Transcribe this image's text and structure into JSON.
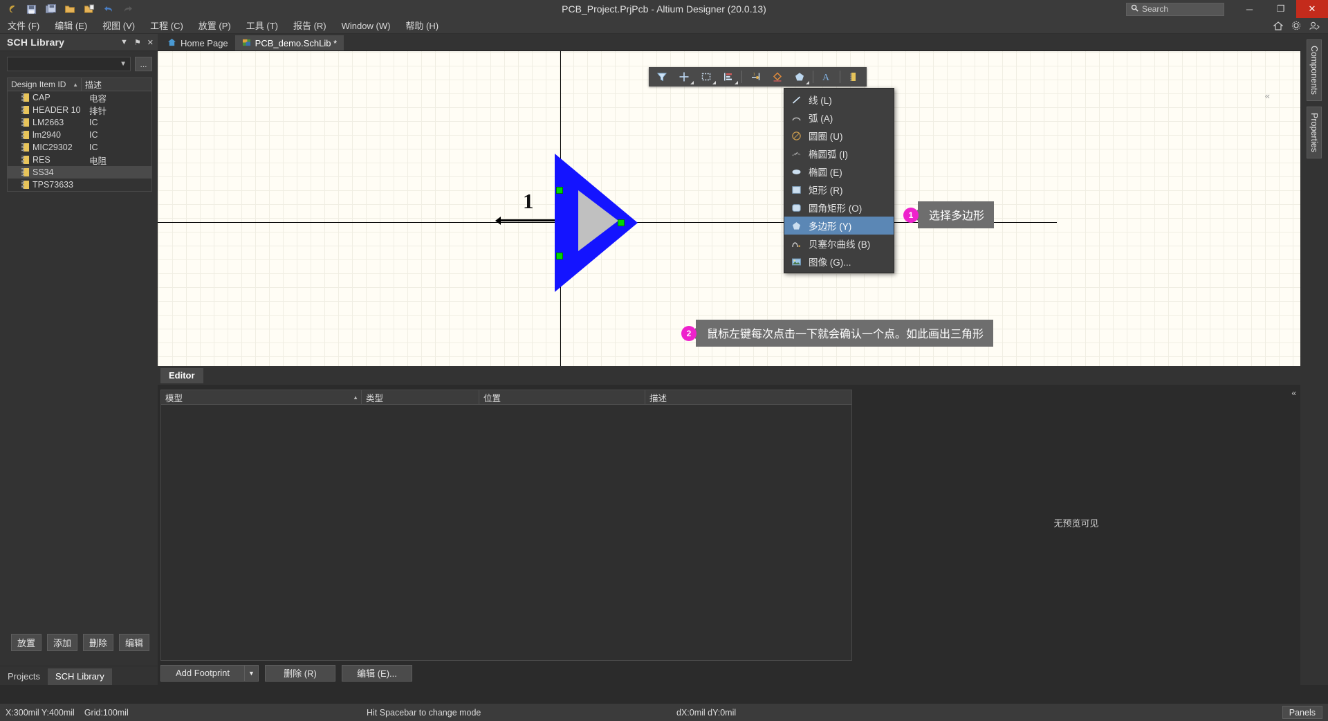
{
  "titlebar": {
    "title": "PCB_Project.PrjPcb - Altium Designer (20.0.13)",
    "search_placeholder": "Search",
    "icons": [
      "altium-logo-icon",
      "save-icon",
      "save-all-icon",
      "open-folder-icon",
      "open-project-icon",
      "undo-icon",
      "redo-icon"
    ],
    "minimize_label": "─",
    "restore_label": "❐",
    "close_label": "✕"
  },
  "menubar": {
    "items": [
      {
        "label": "文件 (F)",
        "key": "F"
      },
      {
        "label": "编辑 (E)",
        "key": "E"
      },
      {
        "label": "视图 (V)",
        "key": "V"
      },
      {
        "label": "工程 (C)",
        "key": "C"
      },
      {
        "label": "放置 (P)",
        "key": "P"
      },
      {
        "label": "工具 (T)",
        "key": "T"
      },
      {
        "label": "报告 (R)",
        "key": "R"
      },
      {
        "label": "Window (W)",
        "key": "W"
      },
      {
        "label": "帮助 (H)",
        "key": "H"
      }
    ],
    "right_icons": [
      "home-icon",
      "gear-icon",
      "user-icon"
    ]
  },
  "sch_library": {
    "title": "SCH Library",
    "collapse_label": "▼",
    "pin_label": "⚑",
    "close_label": "✕",
    "filter_value": "",
    "browse_label": "...",
    "columns": {
      "id": "Design Item ID",
      "desc": "描述"
    },
    "sort_indicator": "▲",
    "items": [
      {
        "name": "CAP",
        "desc": "电容",
        "selected": false
      },
      {
        "name": "HEADER 10",
        "desc": "排针",
        "selected": false
      },
      {
        "name": "LM2663",
        "desc": "IC",
        "selected": false
      },
      {
        "name": "lm2940",
        "desc": "IC",
        "selected": false
      },
      {
        "name": "MIC29302",
        "desc": "IC",
        "selected": false
      },
      {
        "name": "RES",
        "desc": "电阻",
        "selected": false
      },
      {
        "name": "SS34",
        "desc": "",
        "selected": true
      },
      {
        "name": "TPS73633",
        "desc": "",
        "selected": false
      }
    ],
    "buttons": [
      "放置",
      "添加",
      "删除",
      "编辑"
    ],
    "panel_tabs": [
      {
        "label": "Projects",
        "active": false
      },
      {
        "label": "SCH Library",
        "active": true
      }
    ]
  },
  "document_tabs": [
    {
      "label": "Home Page",
      "icon": "home-icon",
      "active": false
    },
    {
      "label": "PCB_demo.SchLib *",
      "icon": "schlib-icon",
      "active": true
    }
  ],
  "canvas": {
    "pin_number": "1",
    "symbol": "triangle-amplifier",
    "vertex_color": "#00d800",
    "body_color": "#1414ff",
    "inner_color": "#c0c0c0",
    "collapse_label": "«"
  },
  "float_toolbar": {
    "buttons": [
      {
        "name": "filter-icon",
        "has_menu": false
      },
      {
        "name": "crosshair-place-icon",
        "has_menu": true
      },
      {
        "name": "select-rectangle-icon",
        "has_menu": true
      },
      {
        "name": "align-icon",
        "has_menu": true
      },
      {
        "name": "place-pin-icon",
        "has_menu": false
      },
      {
        "name": "place-line-icon",
        "has_menu": false
      },
      {
        "name": "place-polygon-icon",
        "has_menu": true
      },
      {
        "name": "place-text-icon",
        "has_menu": false
      },
      {
        "name": "place-component-icon",
        "has_menu": false
      }
    ]
  },
  "dropdown": {
    "items": [
      {
        "label": "线 (L)",
        "icon": "line-icon",
        "highlight": false
      },
      {
        "label": "弧 (A)",
        "icon": "arc-icon",
        "highlight": false
      },
      {
        "label": "圆圈 (U)",
        "icon": "circle-icon",
        "highlight": false
      },
      {
        "label": "椭圆弧 (I)",
        "icon": "elliptical-arc-icon",
        "highlight": false
      },
      {
        "label": "椭圆 (E)",
        "icon": "ellipse-icon",
        "highlight": false
      },
      {
        "label": "矩形 (R)",
        "icon": "rectangle-icon",
        "highlight": false
      },
      {
        "label": "圆角矩形 (O)",
        "icon": "rounded-rectangle-icon",
        "highlight": false
      },
      {
        "label": "多边形 (Y)",
        "icon": "polygon-icon",
        "highlight": true
      },
      {
        "label": "贝塞尔曲线 (B)",
        "icon": "bezier-curve-icon",
        "highlight": false
      },
      {
        "label": "图像 (G)...",
        "icon": "image-icon",
        "highlight": false
      }
    ]
  },
  "callouts": [
    {
      "number": "1",
      "text": "选择多边形"
    },
    {
      "number": "2",
      "text": "鼠标左键每次点击一下就会确认一个点。如此画出三角形"
    }
  ],
  "editor_panel": {
    "tab_label": "Editor",
    "columns": [
      {
        "label": "模型",
        "sorted": true
      },
      {
        "label": "类型",
        "sorted": false
      },
      {
        "label": "位置",
        "sorted": false
      },
      {
        "label": "描述",
        "sorted": false
      }
    ],
    "sort_indicator": "▲",
    "rows": [],
    "preview_text": "无预览可见",
    "collapse_label": "«",
    "buttons": [
      {
        "label": "Add Footprint",
        "has_dropdown": true,
        "arrow": "▼"
      },
      {
        "label": "删除 (R)",
        "has_dropdown": false
      },
      {
        "label": "编辑 (E)...",
        "has_dropdown": false
      }
    ]
  },
  "right_dock": {
    "tabs": [
      "Components",
      "Properties"
    ]
  },
  "statusbar": {
    "coordinates": "X:300mil Y:400mil",
    "grid": "Grid:100mil",
    "hint": "Hit Spacebar to change mode",
    "delta": "dX:0mil dY:0mil",
    "panels_label": "Panels"
  }
}
